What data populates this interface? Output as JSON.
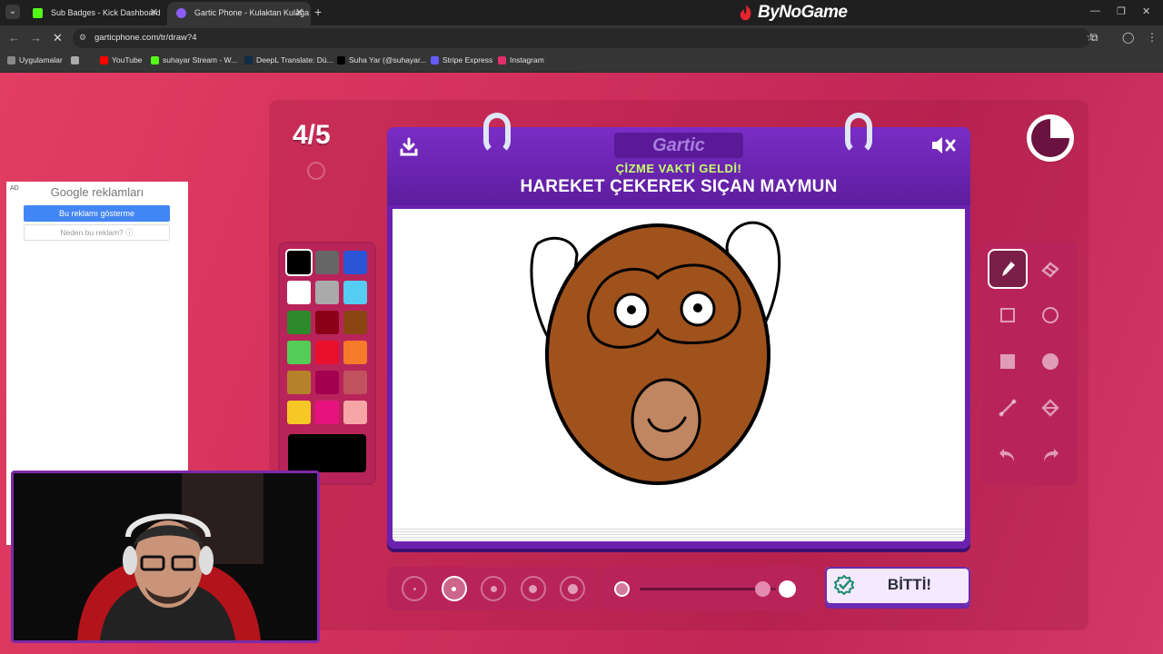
{
  "browser": {
    "tabs": [
      {
        "title": "Sub Badges - Kick Dashboard",
        "favicon_color": "#53fc18",
        "active": false
      },
      {
        "title": "Gartic Phone - Kulaktan Kulağa",
        "favicon_color": "#8b5cf6",
        "active": true
      }
    ],
    "brand": "ByNoGame",
    "url": "garticphone.com/tr/draw?4",
    "bookmarks": [
      {
        "label": "Uygulamalar",
        "icon": "apps-grid-icon",
        "color": "#888888"
      },
      {
        "label": "",
        "icon": "grid-icon",
        "color": "#aaaaaa"
      },
      {
        "label": "YouTube",
        "icon": "youtube-icon",
        "color": "#ff0000"
      },
      {
        "label": "suhayar Stream - W...",
        "icon": "kick-icon",
        "color": "#53fc18"
      },
      {
        "label": "DeepL Translate: Dü...",
        "icon": "deepl-icon",
        "color": "#0f2b46"
      },
      {
        "label": "Suha Yar (@suhayar...",
        "icon": "tiktok-icon",
        "color": "#000000"
      },
      {
        "label": "Stripe Express",
        "icon": "stripe-icon",
        "color": "#635bff"
      },
      {
        "label": "Instagram",
        "icon": "instagram-icon",
        "color": "#e1306c"
      }
    ]
  },
  "game": {
    "round": "4/5",
    "prompt_subtitle": "ÇİZME VAKTİ GELDİ!",
    "prompt": "HAREKET ÇEKEREK SIÇAN MAYMUN",
    "logo": "Gartic",
    "timer_fraction_remaining": 0.25,
    "done_label": "BİTTİ!",
    "palette": [
      "#000000",
      "#666666",
      "#2a55d6",
      "#ffffff",
      "#aaaaaa",
      "#55ccf2",
      "#2c8a2c",
      "#8b0016",
      "#8b4513",
      "#55cc55",
      "#e8102c",
      "#f57a2a",
      "#b5822a",
      "#a3004f",
      "#c0525e",
      "#f5c825",
      "#e8127e",
      "#f5a5a5"
    ],
    "selected_color_index": 0,
    "current_color": "#000000",
    "brush_sizes": [
      1,
      2,
      3,
      4,
      5
    ],
    "selected_brush_size": 2,
    "opacity_fraction": 0.9,
    "tools": [
      {
        "name": "pen-tool",
        "selected": true
      },
      {
        "name": "eraser-tool",
        "selected": false
      },
      {
        "name": "rectangle-outline-tool",
        "selected": false
      },
      {
        "name": "circle-outline-tool",
        "selected": false
      },
      {
        "name": "rectangle-fill-tool",
        "selected": false
      },
      {
        "name": "circle-fill-tool",
        "selected": false
      },
      {
        "name": "line-tool",
        "selected": false
      },
      {
        "name": "bucket-tool",
        "selected": false
      },
      {
        "name": "undo-tool",
        "selected": false
      },
      {
        "name": "redo-tool",
        "selected": false
      }
    ]
  },
  "ad": {
    "tag": "AD",
    "title": "Google reklamları",
    "button": "Bu reklamı gösterme",
    "why": "Neden bu reklam? ⓘ"
  }
}
